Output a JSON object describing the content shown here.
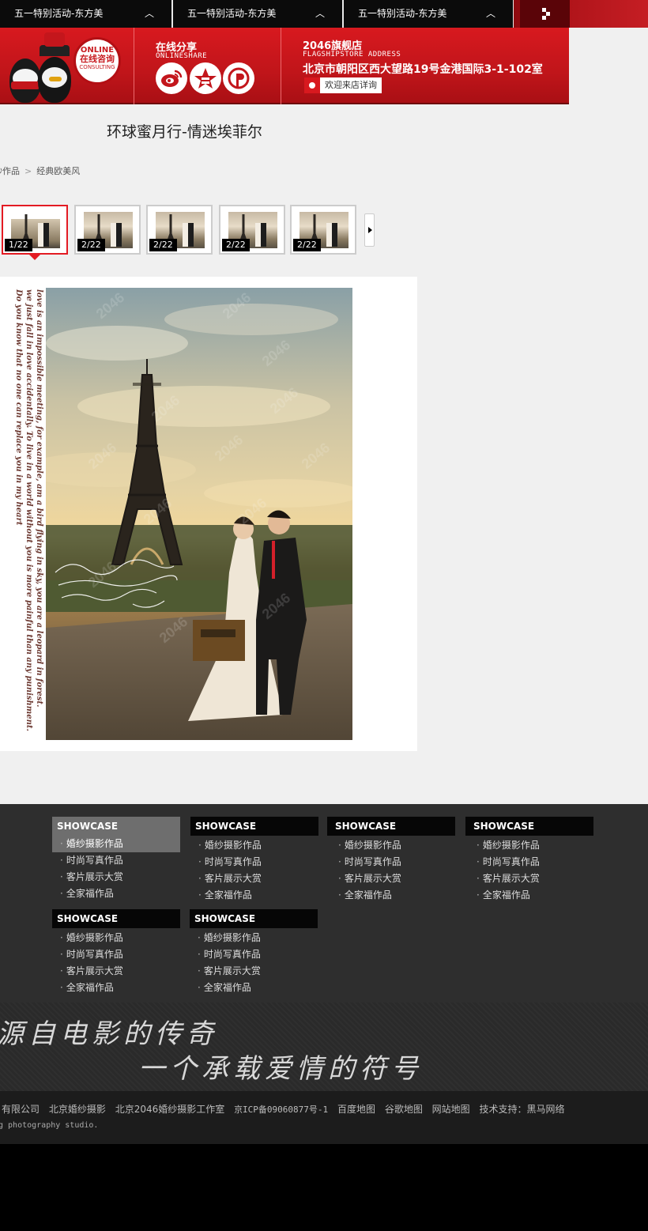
{
  "topbar": {
    "tabs": [
      {
        "label": "五一特别活动-东方美"
      },
      {
        "label": "五一特别活动-东方美"
      },
      {
        "label": "五一特别活动-东方美"
      }
    ]
  },
  "banner": {
    "online": {
      "en": "ONLINE",
      "cn": "在线咨询",
      "sub": "CONSULTING"
    },
    "share": {
      "title": "在线分享",
      "subtitle": "ONLINESHARE"
    },
    "store": {
      "title": "2046旗舰店",
      "subtitle": "FLAGSHIPSTORE ADDRESS",
      "address": "北京市朝阳区西大望路19号金港国际3-1-102室",
      "visit_label": "欢迎来店详询"
    }
  },
  "page": {
    "title": "环球蜜月行-情迷埃菲尔",
    "breadcrumb": [
      "纱作品",
      "经典欧美风"
    ]
  },
  "gallery": {
    "thumbs": [
      {
        "counter": "1/22"
      },
      {
        "counter": "2/22"
      },
      {
        "counter": "2/22"
      },
      {
        "counter": "2/22"
      },
      {
        "counter": "2/22"
      }
    ]
  },
  "photo": {
    "quote_lines": [
      "love is an impossible meeting, for example, am a bird flying in sky, you are a leopard in forest.",
      "we just fall in love accidentally. To live in a world without you is more painful than any punishment.",
      "Do you know that no one can replace you in my heart"
    ],
    "watermark": "2046"
  },
  "footer": {
    "columns": [
      {
        "heading": "SHOWCASE",
        "items": [
          "婚纱摄影作品",
          "时尚写真作品",
          "客片展示大赏",
          "全家福作品"
        ]
      },
      {
        "heading": "SHOWCASE",
        "items": [
          "婚纱摄影作品",
          "时尚写真作品",
          "客片展示大赏",
          "全家福作品"
        ]
      },
      {
        "heading": "SHOWCASE",
        "items": [
          "婚纱摄影作品",
          "时尚写真作品",
          "客片展示大赏",
          "全家福作品"
        ]
      },
      {
        "heading": "SHOWCASE",
        "items": [
          "婚纱摄影作品",
          "时尚写真作品",
          "客片展示大赏",
          "全家福作品"
        ]
      },
      {
        "heading": "SHOWCASE",
        "items": [
          "婚纱摄影作品",
          "时尚写真作品",
          "客片展示大赏",
          "全家福作品"
        ]
      },
      {
        "heading": "SHOWCASE",
        "items": [
          "婚纱摄影作品",
          "时尚写真作品",
          "客片展示大赏",
          "全家福作品"
        ]
      }
    ],
    "slogan": {
      "line1": "源自电影的传奇",
      "line2": "一个承载爱情的符号"
    },
    "links": [
      "有限公司",
      "北京婚纱摄影",
      "北京2046婚纱摄影工作室",
      "京ICP备09060877号-1",
      "百度地图",
      "谷歌地图",
      "网站地图",
      "技术支持：黑马网络"
    ],
    "copyright_en": "g photography studio."
  },
  "colors": {
    "brand_red": "#d8191f",
    "footer_bg": "#2e2e2e",
    "active_border": "#e31b23"
  }
}
